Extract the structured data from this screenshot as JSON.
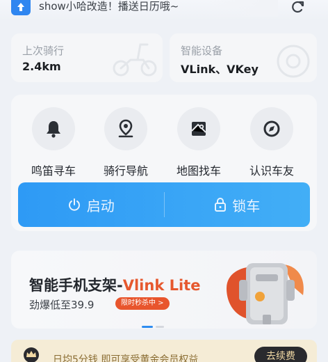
{
  "header": {
    "message": "show小哈改造！播送日历哦~",
    "icons": {
      "app": "app-logo-icon",
      "refresh": "refresh-icon"
    }
  },
  "stats": {
    "last_ride": {
      "label": "上次骑行",
      "value": "2.4km",
      "icon": "scooter-icon"
    },
    "smart_device": {
      "label": "智能设备",
      "value": "VLink、VKey",
      "icon": "device-icon"
    }
  },
  "actions": [
    {
      "label": "鸣笛寻车",
      "icon": "bell-icon"
    },
    {
      "label": "骑行导航",
      "icon": "location-pin-icon"
    },
    {
      "label": "地图找车",
      "icon": "map-icon"
    },
    {
      "label": "认识车友",
      "icon": "compass-icon"
    }
  ],
  "controls": {
    "start_label": "启动",
    "lock_label": "锁车",
    "accent": "#2e9af5"
  },
  "ad": {
    "title_main": "智能手机支架-",
    "title_highlight": "Vlink Lite",
    "subtitle": "劲爆低至39.9",
    "tag": "限时秒杀中 >",
    "highlight_color": "#e6582e"
  },
  "vip": {
    "text": "日均5分钱 即可享受黄金会员权益",
    "button": "去续费"
  }
}
